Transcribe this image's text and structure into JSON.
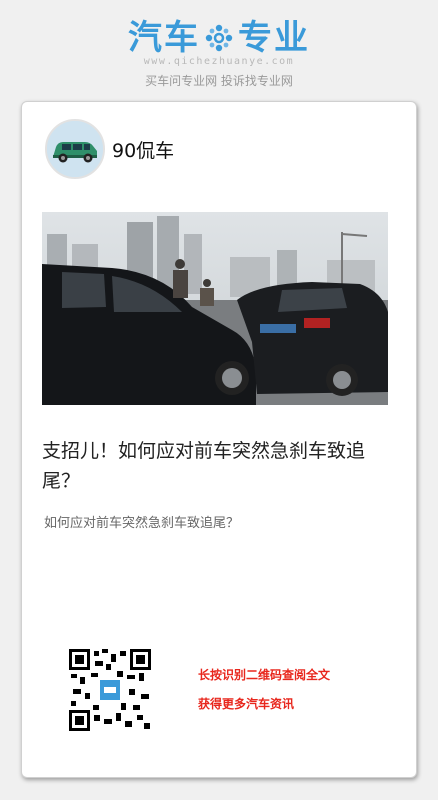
{
  "header": {
    "logo_left": "汽车",
    "logo_right": "专业",
    "site_url": "www.qichezhuanye.com",
    "tagline": "买车问专业网 投诉找专业网"
  },
  "author": {
    "name": "90侃车"
  },
  "article": {
    "title": "支招儿！如何应对前车突然急刹车致追尾？",
    "description": "如何应对前车突然急刹车致追尾？"
  },
  "cta": {
    "line1": "长按识别二维码查阅全文",
    "line2": "获得更多汽车资讯"
  },
  "colors": {
    "brand": "#3a9ad9",
    "cta": "#e8271d"
  }
}
